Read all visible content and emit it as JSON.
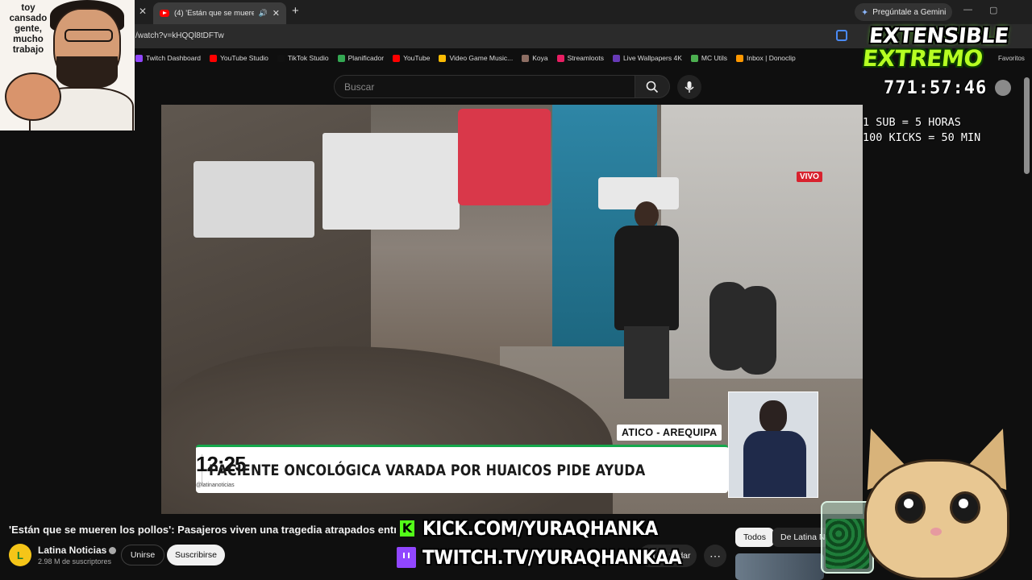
{
  "browser": {
    "active_tab_title": "(4) 'Están que se mueren lo",
    "url": "/watch?v=kHQQl8tDFTw",
    "gemini_label": "Pregúntale a Gemini",
    "bookmarks": [
      {
        "label": "Twitch Dashboard",
        "color": "#9146ff"
      },
      {
        "label": "YouTube Studio",
        "color": "#ff0000"
      },
      {
        "label": "TikTok Studio",
        "color": "#111111"
      },
      {
        "label": "Planificador",
        "color": "#34a853"
      },
      {
        "label": "YouTube",
        "color": "#ff0000"
      },
      {
        "label": "Video Game Music...",
        "color": "#fbbc04"
      },
      {
        "label": "Koya",
        "color": "#8d6e63"
      },
      {
        "label": "Streamloots",
        "color": "#e91e63"
      },
      {
        "label": "Live Wallpapers 4K",
        "color": "#673ab7"
      },
      {
        "label": "MC Utils",
        "color": "#4caf50"
      },
      {
        "label": "Inbox | Donoclip",
        "color": "#ff9800"
      }
    ],
    "other_bookmarks": "Favoritos"
  },
  "youtube": {
    "search_placeholder": "Buscar",
    "video": {
      "live_badge": "VIVO",
      "location": "ATICO - AREQUIPA",
      "clock": "12:25",
      "handle": "@latinanoticias",
      "headline": "PACIENTE ONCOLÓGICA VARADA POR HUAICOS PIDE AYUDA"
    },
    "title": "'Están que se mueren los pollos': Pasajeros viven una tragedia atrapados entr",
    "channel": {
      "logo_letter": "L",
      "name": "Latina Noticias",
      "subscribers": "2.98 M de suscriptores"
    },
    "join_label": "Unirse",
    "subscribe_label": "Suscribirse",
    "save_label": "Guardar",
    "more_label": "⋯",
    "chips": [
      "Todos",
      "De Latina N"
    ]
  },
  "stream_overlay": {
    "cam_caption": "toy\ncansado\ngente,\nmucho\ntrabajo",
    "brand_line1": "EXTENSIBLE",
    "brand_line2": "EXTREMO",
    "timer": "771:57:46",
    "rules": [
      "1 SUB = 5 HORAS",
      "100 KICKS = 50 MIN"
    ],
    "kick_url": "KICK.COM/YURAQHANKA",
    "twitch_url": "TWITCH.TV/YURAQHANKAA",
    "kick_logo": "K"
  }
}
